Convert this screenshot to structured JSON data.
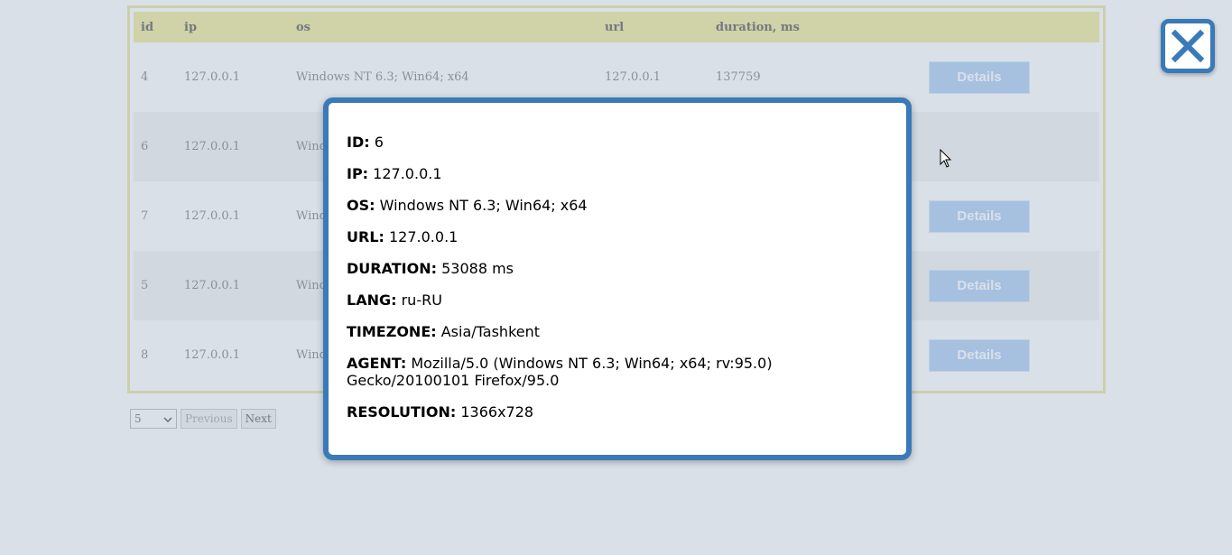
{
  "table": {
    "headers": [
      "id",
      "ip",
      "os",
      "url",
      "duration, ms"
    ],
    "rows": [
      {
        "id": "4",
        "ip": "127.0.0.1",
        "os": "Windows NT 6.3; Win64; x64",
        "url": "127.0.0.1",
        "duration": "137759",
        "details": "Details"
      },
      {
        "id": "6",
        "ip": "127.0.0.1",
        "os": "Wind",
        "url": "",
        "duration": "",
        "details": ""
      },
      {
        "id": "7",
        "ip": "127.0.0.1",
        "os": "Wind",
        "url": "",
        "duration": "",
        "details": "Details"
      },
      {
        "id": "5",
        "ip": "127.0.0.1",
        "os": "Wind",
        "url": "",
        "duration": "",
        "details": "Details"
      },
      {
        "id": "8",
        "ip": "127.0.0.1",
        "os": "Wind",
        "url": "",
        "duration": "",
        "details": "Details"
      }
    ]
  },
  "pager": {
    "page_size": "5",
    "previous": "Previous",
    "next": "Next"
  },
  "modal": {
    "fields": [
      {
        "label": "ID:",
        "value": "6"
      },
      {
        "label": "IP:",
        "value": "127.0.0.1"
      },
      {
        "label": "OS:",
        "value": "Windows NT 6.3; Win64; x64"
      },
      {
        "label": "URL:",
        "value": "127.0.0.1"
      },
      {
        "label": "DURATION:",
        "value": "53088 ms"
      },
      {
        "label": "LANG:",
        "value": "ru-RU"
      },
      {
        "label": "TIMEZONE:",
        "value": "Asia/Tashkent"
      },
      {
        "label": "AGENT:",
        "value": "Mozilla/5.0 (Windows NT 6.3; Win64; x64; rv:95.0) Gecko/20100101 Firefox/95.0"
      },
      {
        "label": "RESOLUTION:",
        "value": "1366x728"
      }
    ]
  },
  "icons": {
    "close": "close-icon",
    "cursor": "mouse-cursor-icon",
    "select_arrow": "chevron-down-icon"
  },
  "colors": {
    "header_bg": "#f2ea9f",
    "accent_blue": "#3a7ab8",
    "details_button": "#b3d1f2",
    "overlay": "rgba(140,160,185,0.33)"
  }
}
